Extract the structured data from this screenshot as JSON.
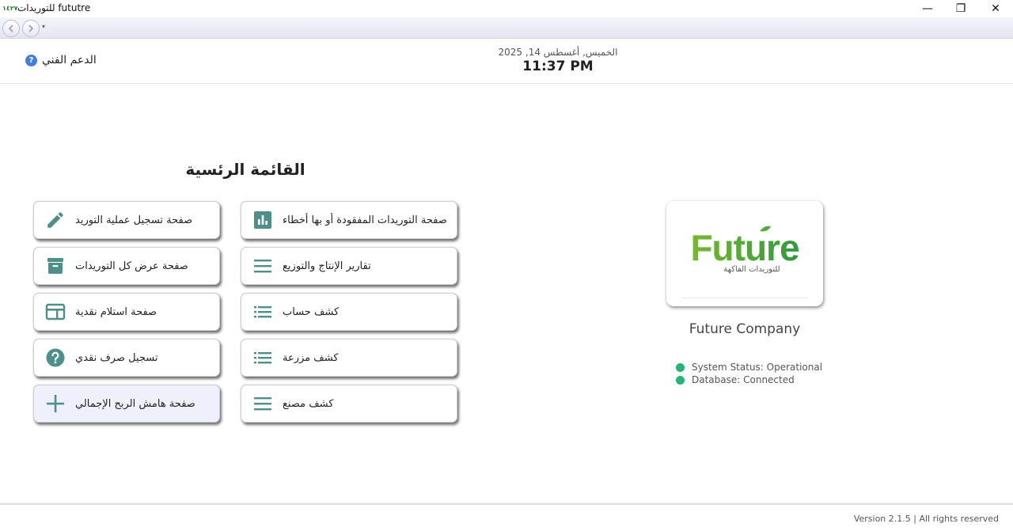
{
  "window": {
    "title": "للتوريدات fututre",
    "app_icon_text": "١٤٢٧",
    "minimize_glyph": "—",
    "maximize_glyph": "❐",
    "close_glyph": "✕"
  },
  "header": {
    "support_label": "الدعم الفني",
    "support_icon": "question-circle-icon",
    "date": "الخميس, أغسطس 14, 2025",
    "time": "11:37 PM"
  },
  "menu": {
    "title": "القائمة الرئسية",
    "accent_color": "#4f8f8a",
    "items": [
      {
        "label": "صفحة تسجيل عملية التوريد",
        "icon": "pencil-icon"
      },
      {
        "label": "صفحة التوريدات المفقودة أو بها أخطاء",
        "icon": "bar-chart-icon"
      },
      {
        "label": "صفحة عرض كل التوريدات",
        "icon": "archive-box-icon"
      },
      {
        "label": "تقارير الإنتاج والتوزيع",
        "icon": "menu-lines-icon"
      },
      {
        "label": "صفحة استلام نقدية",
        "icon": "wallet-card-icon"
      },
      {
        "label": "كشف حساب",
        "icon": "list-icon"
      },
      {
        "label": "تسجيل صرف نقدي",
        "icon": "help-circle-icon"
      },
      {
        "label": "كشف مزرعة",
        "icon": "list-icon"
      },
      {
        "label": "صفحة هامش الربح الإجمالي",
        "icon": "plus-icon"
      },
      {
        "label": "كشف مصنع",
        "icon": "menu-lines-icon"
      }
    ]
  },
  "company": {
    "logo_text": "Future",
    "logo_subtext": "للتوريدات الفاكهة",
    "name": "Future Company",
    "status_color": "#22b573",
    "system_status": "System Status: Operational",
    "database_status": "Database: Connected"
  },
  "footer": {
    "version": "Version 2.1.5 | All rights reserved"
  }
}
